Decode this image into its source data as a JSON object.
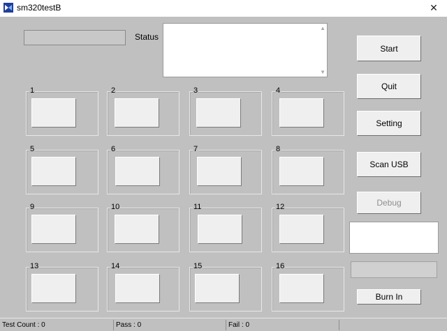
{
  "window": {
    "title": "sm320testB",
    "close_glyph": "✕"
  },
  "status_label": "Status",
  "status_text": "",
  "slots": [
    "1",
    "2",
    "3",
    "4",
    "5",
    "6",
    "7",
    "8",
    "9",
    "10",
    "11",
    "12",
    "13",
    "14",
    "15",
    "16"
  ],
  "buttons": {
    "start": "Start",
    "quit": "Quit",
    "setting": "Setting",
    "scan_usb": "Scan USB",
    "debug": "Debug",
    "burn_in": "Burn In"
  },
  "statusbar": {
    "test_count": "Test Count : 0",
    "pass": "Pass : 0",
    "fail": "Fail : 0"
  }
}
